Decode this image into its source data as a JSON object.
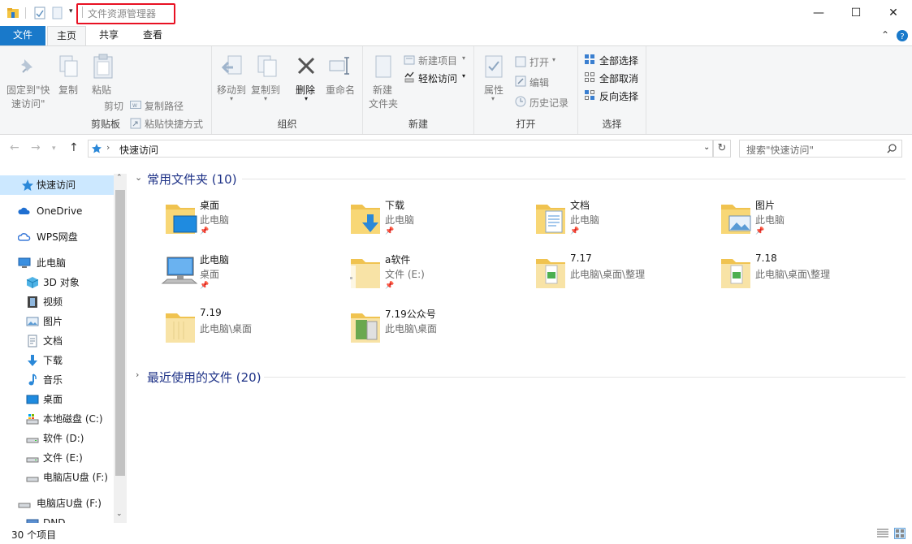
{
  "titlebar": {
    "title": "文件资源管理器",
    "minimize": "—",
    "maximize": "☐",
    "close": "✕"
  },
  "tabs": [
    {
      "label": "文件"
    },
    {
      "label": "主页"
    },
    {
      "label": "共享"
    },
    {
      "label": "查看"
    }
  ],
  "ribbon": {
    "clipboard": {
      "label": "剪贴板",
      "pin_line1": "固定到\"快",
      "pin_line2": "速访问\"",
      "copy": "复制",
      "paste": "粘贴",
      "copy_path": "复制路径",
      "paste_shortcut": "粘贴快捷方式",
      "cut": "剪切"
    },
    "organize": {
      "label": "组织",
      "move_to": "移动到",
      "copy_to": "复制到",
      "delete": "删除",
      "rename": "重命名"
    },
    "new": {
      "label": "新建",
      "new_folder_line1": "新建",
      "new_folder_line2": "文件夹",
      "new_item": "新建项目",
      "easy_access": "轻松访问"
    },
    "open": {
      "label": "打开",
      "properties": "属性",
      "open": "打开",
      "edit": "编辑",
      "history": "历史记录"
    },
    "select": {
      "label": "选择",
      "select_all": "全部选择",
      "select_none": "全部取消",
      "invert": "反向选择"
    }
  },
  "address": {
    "path": "快速访问",
    "search_placeholder": "搜索\"快速访问\""
  },
  "sidebar": {
    "items": [
      {
        "label": "快速访问"
      },
      {
        "label": "OneDrive"
      },
      {
        "label": "WPS网盘"
      },
      {
        "label": "此电脑"
      },
      {
        "label": "3D 对象"
      },
      {
        "label": "视频"
      },
      {
        "label": "图片"
      },
      {
        "label": "文档"
      },
      {
        "label": "下载"
      },
      {
        "label": "音乐"
      },
      {
        "label": "桌面"
      },
      {
        "label": "本地磁盘 (C:)"
      },
      {
        "label": "软件 (D:)"
      },
      {
        "label": "文件 (E:)"
      },
      {
        "label": "电脑店U盘 (F:)"
      },
      {
        "label": "电脑店U盘 (F:)"
      },
      {
        "label": "DND"
      }
    ]
  },
  "sections": {
    "frequent": "常用文件夹 (10)",
    "recent": "最近使用的文件 (20)"
  },
  "folders": [
    {
      "name": "桌面",
      "location": "此电脑"
    },
    {
      "name": "下载",
      "location": "此电脑"
    },
    {
      "name": "文档",
      "location": "此电脑"
    },
    {
      "name": "图片",
      "location": "此电脑"
    },
    {
      "name": "此电脑",
      "location": "桌面"
    },
    {
      "name": "a软件",
      "location": "文件 (E:)"
    },
    {
      "name": "7.17",
      "location": "此电脑\\桌面\\整理"
    },
    {
      "name": "7.18",
      "location": "此电脑\\桌面\\整理"
    },
    {
      "name": "7.19",
      "location": "此电脑\\桌面"
    },
    {
      "name": "7.19公众号",
      "location": "此电脑\\桌面"
    }
  ],
  "status": {
    "count": "30 个项目"
  },
  "colors": {
    "accent": "#1979ca",
    "highlight": "#e81123",
    "selected_nav": "#cce8ff",
    "section_title": "#1e3287"
  }
}
